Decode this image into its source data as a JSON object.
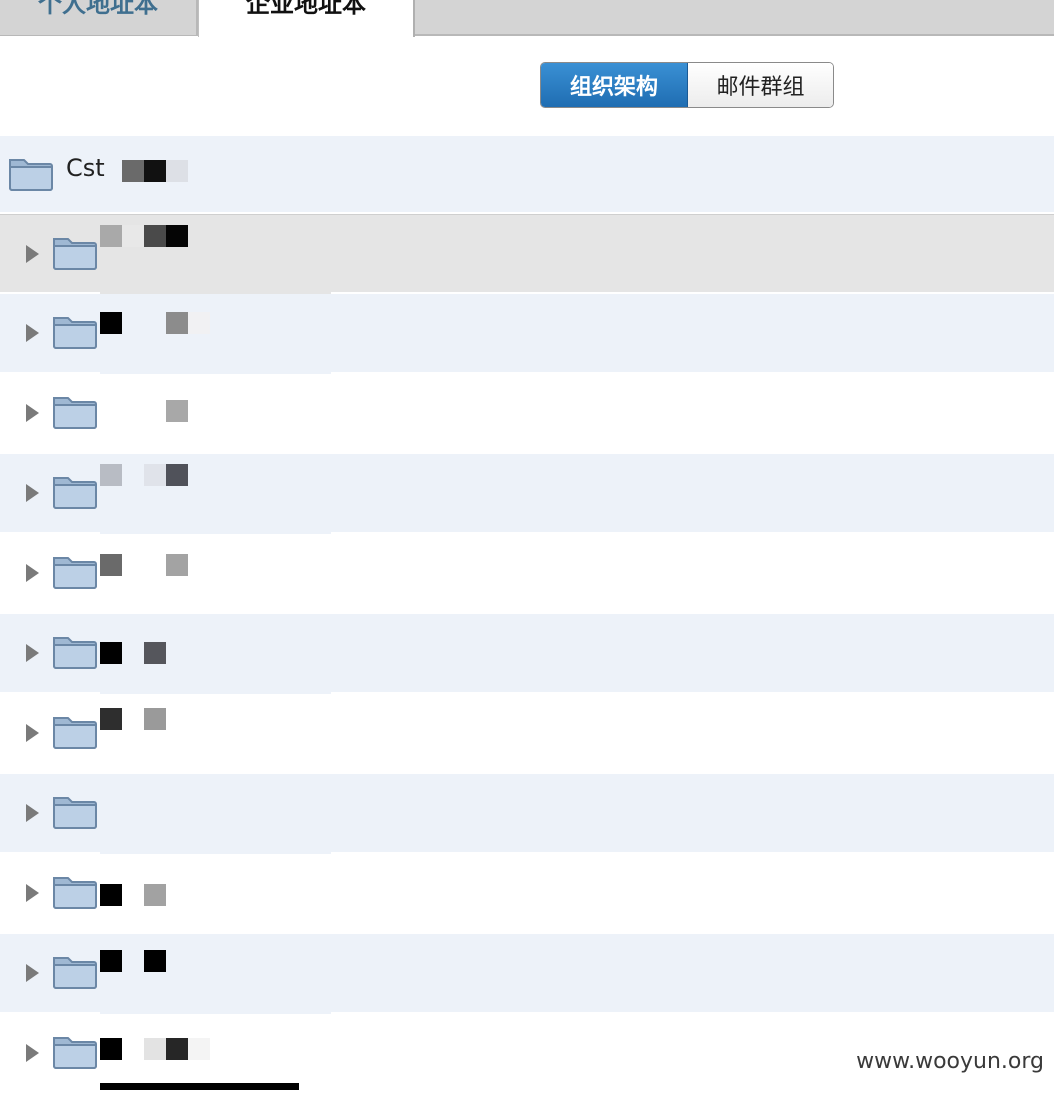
{
  "tabs": {
    "personal": "个人地址本",
    "enterprise": "企业地址本"
  },
  "toggle": {
    "org": "组织架构",
    "mail_groups": "邮件群组"
  },
  "tree": {
    "root_label": "Cst"
  },
  "watermark": "www.wooyun.org",
  "colors": {
    "accent": "#1f6db2",
    "row_alt": "#edf2f9",
    "row_selected": "#e5e5e5",
    "folder": "#a9c2dc"
  }
}
